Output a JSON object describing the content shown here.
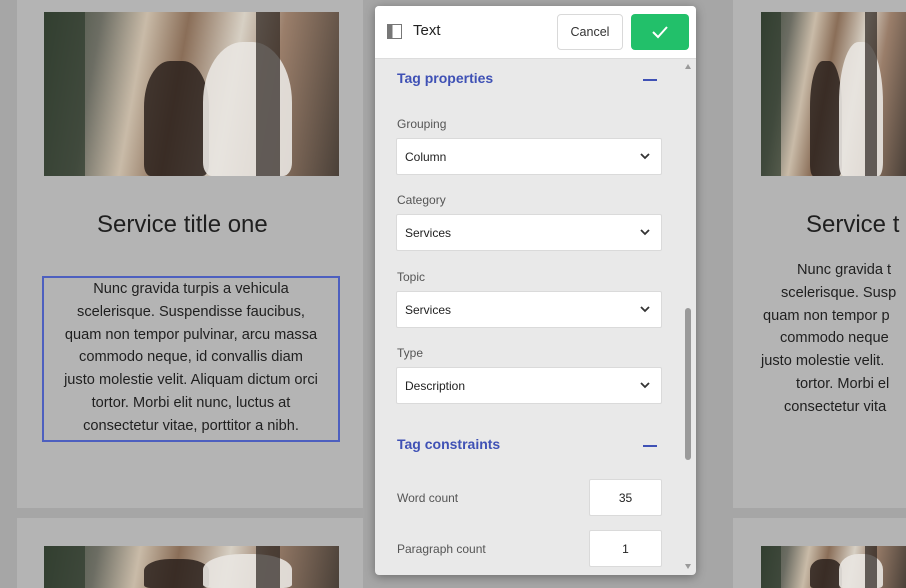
{
  "cards": [
    {
      "title": "Service title one",
      "description_lines": [
        "Nunc gravida turpis a vehicula",
        "scelerisque. Suspendisse faucibus,",
        "quam non tempor pulvinar, arcu massa",
        "commodo neque, id convallis diam",
        "justo molestie velit. Aliquam dictum orci",
        "tortor. Morbi elit nunc, luctus at",
        "consectetur vitae, porttitor a nibh."
      ]
    },
    {
      "title": "Service t",
      "description_lines": [
        "Nunc gravida t",
        "scelerisque. Susp",
        "quam non tempor p",
        "commodo neque",
        "justo molestie velit.",
        "tortor. Morbi el",
        "consectetur vita"
      ]
    }
  ],
  "panel": {
    "title": "Text",
    "icon": "panel-layout-icon",
    "cancel_label": "Cancel",
    "confirm_icon": "checkmark-icon",
    "sections": {
      "tag_properties": "Tag properties",
      "tag_constraints": "Tag constraints"
    },
    "fields": {
      "grouping": {
        "label": "Grouping",
        "value": "Column"
      },
      "category": {
        "label": "Category",
        "value": "Services"
      },
      "topic": {
        "label": "Topic",
        "value": "Services"
      },
      "type": {
        "label": "Type",
        "value": "Description"
      },
      "word_count": {
        "label": "Word count",
        "value": "35"
      },
      "paragraph_count": {
        "label": "Paragraph count",
        "value": "1"
      }
    }
  },
  "colors": {
    "accent": "#3f51b5",
    "confirm": "#22c06a",
    "selection": "#4d5fbf"
  }
}
